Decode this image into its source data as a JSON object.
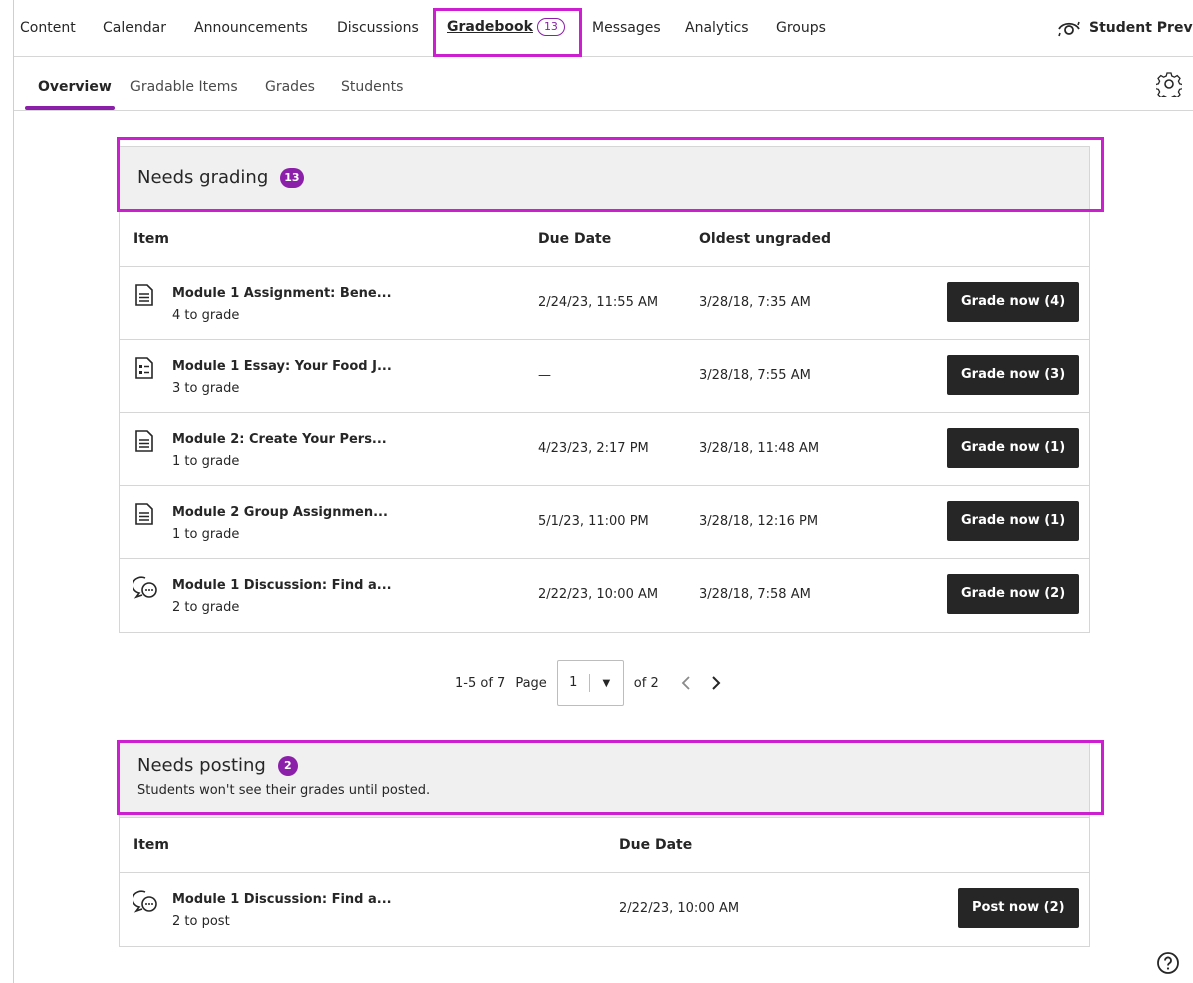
{
  "top_nav": {
    "tabs": [
      "Content",
      "Calendar",
      "Announcements",
      "Discussions"
    ],
    "gradebook_label": "Gradebook",
    "gradebook_count": "13",
    "tabs_after": [
      "Messages",
      "Analytics",
      "Groups"
    ],
    "student_preview": "Student Preview"
  },
  "sub_nav": {
    "tabs": [
      "Overview",
      "Gradable Items",
      "Grades",
      "Students"
    ]
  },
  "needs_grading": {
    "title": "Needs grading",
    "count": "13",
    "columns": [
      "Item",
      "Due Date",
      "Oldest ungraded"
    ],
    "rows": [
      {
        "icon": "assignment-icon",
        "name": "Module 1 Assignment: Bene...",
        "count": "4 to grade",
        "due": "2/24/23, 11:55 AM",
        "oldest": "3/28/18, 7:35 AM",
        "button": "Grade now (4)"
      },
      {
        "icon": "test-icon",
        "name": "Module 1 Essay: Your Food J...",
        "count": "3 to grade",
        "due": "—",
        "oldest": "3/28/18, 7:55 AM",
        "button": "Grade now (3)"
      },
      {
        "icon": "assignment-icon",
        "name": "Module 2: Create Your Pers...",
        "count": "1 to grade",
        "due": "4/23/23, 2:17 PM",
        "oldest": "3/28/18, 11:48 AM",
        "button": "Grade now (1)"
      },
      {
        "icon": "assignment-icon",
        "name": "Module 2 Group Assignmen...",
        "count": "1 to grade",
        "due": "5/1/23, 11:00 PM",
        "oldest": "3/28/18, 12:16 PM",
        "button": "Grade now (1)"
      },
      {
        "icon": "discussion-icon",
        "name": "Module 1 Discussion: Find a...",
        "count": "2 to grade",
        "due": "2/22/23, 10:00 AM",
        "oldest": "3/28/18, 7:58 AM",
        "button": "Grade now (2)"
      }
    ]
  },
  "pagination": {
    "range": "1-5 of 7",
    "page_label": "Page",
    "page_value": "1",
    "of_label": "of 2"
  },
  "needs_posting": {
    "title": "Needs posting",
    "count": "2",
    "subtitle": "Students won't see their grades until posted.",
    "columns": [
      "Item",
      "Due Date"
    ],
    "rows": [
      {
        "icon": "discussion-icon",
        "name": "Module 1 Discussion: Find a...",
        "count": "2 to post",
        "due": "2/22/23, 10:00 AM",
        "button": "Post now (2)"
      }
    ]
  },
  "colors": {
    "accent": "#8b1fa9",
    "highlight": "#cc1fd0",
    "button": "#262626"
  }
}
